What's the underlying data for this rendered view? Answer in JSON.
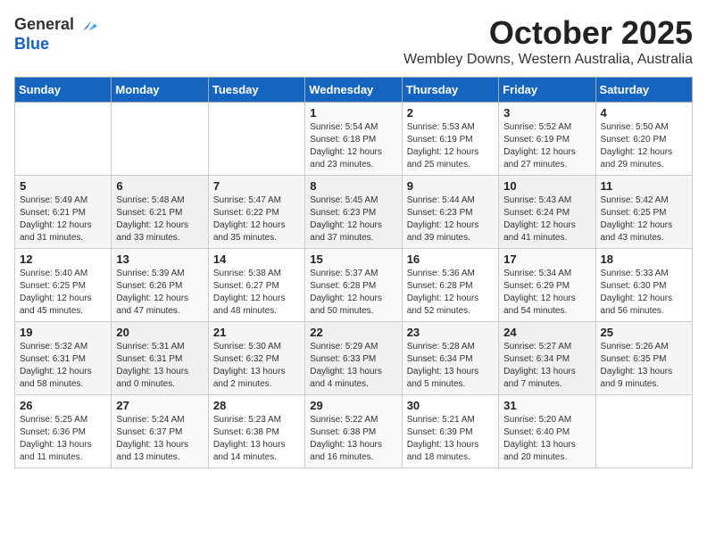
{
  "logo": {
    "line1": "General",
    "line2": "Blue"
  },
  "title": "October 2025",
  "location": "Wembley Downs, Western Australia, Australia",
  "days_of_week": [
    "Sunday",
    "Monday",
    "Tuesday",
    "Wednesday",
    "Thursday",
    "Friday",
    "Saturday"
  ],
  "weeks": [
    [
      {
        "day": "",
        "info": ""
      },
      {
        "day": "",
        "info": ""
      },
      {
        "day": "",
        "info": ""
      },
      {
        "day": "1",
        "info": "Sunrise: 5:54 AM\nSunset: 6:18 PM\nDaylight: 12 hours\nand 23 minutes."
      },
      {
        "day": "2",
        "info": "Sunrise: 5:53 AM\nSunset: 6:19 PM\nDaylight: 12 hours\nand 25 minutes."
      },
      {
        "day": "3",
        "info": "Sunrise: 5:52 AM\nSunset: 6:19 PM\nDaylight: 12 hours\nand 27 minutes."
      },
      {
        "day": "4",
        "info": "Sunrise: 5:50 AM\nSunset: 6:20 PM\nDaylight: 12 hours\nand 29 minutes."
      }
    ],
    [
      {
        "day": "5",
        "info": "Sunrise: 5:49 AM\nSunset: 6:21 PM\nDaylight: 12 hours\nand 31 minutes."
      },
      {
        "day": "6",
        "info": "Sunrise: 5:48 AM\nSunset: 6:21 PM\nDaylight: 12 hours\nand 33 minutes."
      },
      {
        "day": "7",
        "info": "Sunrise: 5:47 AM\nSunset: 6:22 PM\nDaylight: 12 hours\nand 35 minutes."
      },
      {
        "day": "8",
        "info": "Sunrise: 5:45 AM\nSunset: 6:23 PM\nDaylight: 12 hours\nand 37 minutes."
      },
      {
        "day": "9",
        "info": "Sunrise: 5:44 AM\nSunset: 6:23 PM\nDaylight: 12 hours\nand 39 minutes."
      },
      {
        "day": "10",
        "info": "Sunrise: 5:43 AM\nSunset: 6:24 PM\nDaylight: 12 hours\nand 41 minutes."
      },
      {
        "day": "11",
        "info": "Sunrise: 5:42 AM\nSunset: 6:25 PM\nDaylight: 12 hours\nand 43 minutes."
      }
    ],
    [
      {
        "day": "12",
        "info": "Sunrise: 5:40 AM\nSunset: 6:25 PM\nDaylight: 12 hours\nand 45 minutes."
      },
      {
        "day": "13",
        "info": "Sunrise: 5:39 AM\nSunset: 6:26 PM\nDaylight: 12 hours\nand 47 minutes."
      },
      {
        "day": "14",
        "info": "Sunrise: 5:38 AM\nSunset: 6:27 PM\nDaylight: 12 hours\nand 48 minutes."
      },
      {
        "day": "15",
        "info": "Sunrise: 5:37 AM\nSunset: 6:28 PM\nDaylight: 12 hours\nand 50 minutes."
      },
      {
        "day": "16",
        "info": "Sunrise: 5:36 AM\nSunset: 6:28 PM\nDaylight: 12 hours\nand 52 minutes."
      },
      {
        "day": "17",
        "info": "Sunrise: 5:34 AM\nSunset: 6:29 PM\nDaylight: 12 hours\nand 54 minutes."
      },
      {
        "day": "18",
        "info": "Sunrise: 5:33 AM\nSunset: 6:30 PM\nDaylight: 12 hours\nand 56 minutes."
      }
    ],
    [
      {
        "day": "19",
        "info": "Sunrise: 5:32 AM\nSunset: 6:31 PM\nDaylight: 12 hours\nand 58 minutes."
      },
      {
        "day": "20",
        "info": "Sunrise: 5:31 AM\nSunset: 6:31 PM\nDaylight: 13 hours\nand 0 minutes."
      },
      {
        "day": "21",
        "info": "Sunrise: 5:30 AM\nSunset: 6:32 PM\nDaylight: 13 hours\nand 2 minutes."
      },
      {
        "day": "22",
        "info": "Sunrise: 5:29 AM\nSunset: 6:33 PM\nDaylight: 13 hours\nand 4 minutes."
      },
      {
        "day": "23",
        "info": "Sunrise: 5:28 AM\nSunset: 6:34 PM\nDaylight: 13 hours\nand 5 minutes."
      },
      {
        "day": "24",
        "info": "Sunrise: 5:27 AM\nSunset: 6:34 PM\nDaylight: 13 hours\nand 7 minutes."
      },
      {
        "day": "25",
        "info": "Sunrise: 5:26 AM\nSunset: 6:35 PM\nDaylight: 13 hours\nand 9 minutes."
      }
    ],
    [
      {
        "day": "26",
        "info": "Sunrise: 5:25 AM\nSunset: 6:36 PM\nDaylight: 13 hours\nand 11 minutes."
      },
      {
        "day": "27",
        "info": "Sunrise: 5:24 AM\nSunset: 6:37 PM\nDaylight: 13 hours\nand 13 minutes."
      },
      {
        "day": "28",
        "info": "Sunrise: 5:23 AM\nSunset: 6:38 PM\nDaylight: 13 hours\nand 14 minutes."
      },
      {
        "day": "29",
        "info": "Sunrise: 5:22 AM\nSunset: 6:38 PM\nDaylight: 13 hours\nand 16 minutes."
      },
      {
        "day": "30",
        "info": "Sunrise: 5:21 AM\nSunset: 6:39 PM\nDaylight: 13 hours\nand 18 minutes."
      },
      {
        "day": "31",
        "info": "Sunrise: 5:20 AM\nSunset: 6:40 PM\nDaylight: 13 hours\nand 20 minutes."
      },
      {
        "day": "",
        "info": ""
      }
    ]
  ]
}
